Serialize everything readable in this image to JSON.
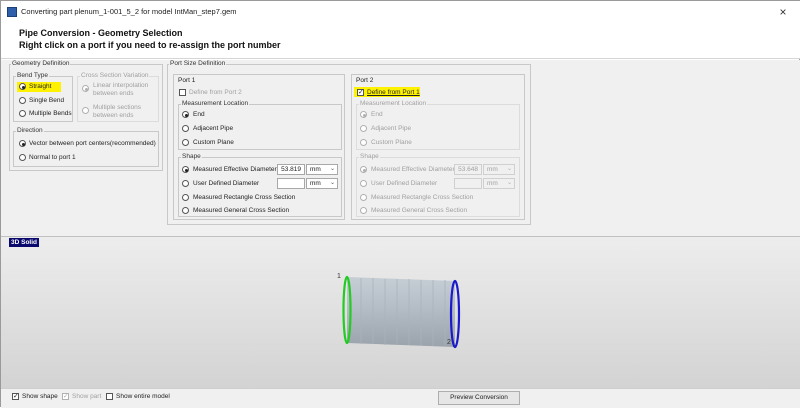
{
  "window": {
    "title": "Converting part plenum_1-001_5_2 for model IntMan_step7.gem",
    "close": "×"
  },
  "header": {
    "title": "Pipe Conversion - Geometry Selection",
    "subtitle": "Right click on a port if you need to re-assign the port number"
  },
  "geometry_definition": {
    "group_label": "Geometry Definition",
    "bend_type": {
      "label": "Bend Type",
      "options": [
        {
          "label": "Straight",
          "selected": true
        },
        {
          "label": "Single Bend",
          "selected": false
        },
        {
          "label": "Multiple Bends",
          "selected": false
        }
      ]
    },
    "cross_section": {
      "label": "Cross Section Variation",
      "options": [
        {
          "line1": "Linear interpolation",
          "line2": "between ends",
          "selected": true
        },
        {
          "line1": "Multiple sections",
          "line2": "between ends",
          "selected": false
        }
      ]
    },
    "direction": {
      "label": "Direction",
      "options": [
        {
          "label": "Vector between port centers(recommended)",
          "selected": true
        },
        {
          "label": "Normal to port 1",
          "selected": false
        }
      ]
    }
  },
  "port_size_definition": {
    "group_label": "Port Size Definition",
    "port1": {
      "label": "Port 1",
      "define_from": {
        "label": "Define from Port 2",
        "checked": false
      },
      "measurement": {
        "label": "Measurement Location",
        "options": [
          "End",
          "Adjacent Pipe",
          "Custom Plane"
        ],
        "selected": "End"
      },
      "shape": {
        "label": "Shape",
        "options": [
          "Measured Effective Diameter",
          "User Defined Diameter",
          "Measured Rectangle Cross Section",
          "Measured General Cross Section"
        ],
        "selected": "Measured Effective Diameter",
        "effective_diameter": "53.819",
        "effective_unit": "mm",
        "user_diameter": "",
        "user_unit": "mm"
      }
    },
    "port2": {
      "label": "Port 2",
      "define_from": {
        "label": "Define from Port 1",
        "checked": true
      },
      "measurement": {
        "label": "Measurement Location",
        "options": [
          "End",
          "Adjacent Pipe",
          "Custom Plane"
        ],
        "selected": "End"
      },
      "shape": {
        "label": "Shape",
        "options": [
          "Measured Effective Diameter",
          "User Defined Diameter",
          "Measured Rectangle Cross Section",
          "Measured General Cross Section"
        ],
        "selected": "Measured Effective Diameter",
        "effective_diameter": "53.648",
        "effective_unit": "mm",
        "user_diameter": "",
        "user_unit": "mm"
      }
    }
  },
  "viewport": {
    "tag": "3D Solid",
    "port1_marker": "1",
    "port2_marker": "2"
  },
  "footer": {
    "show_shape": {
      "label": "Show shape",
      "checked": true
    },
    "show_part": {
      "label": "Show part",
      "checked": true
    },
    "show_entire_model": {
      "label": "Show entire model",
      "checked": false
    },
    "preview_button": "Preview Conversion"
  },
  "colors": {
    "highlight": "#fff200",
    "port1_ring": "#22cc22",
    "port2_ring": "#1a1acc",
    "view_tag_bg": "#0a0a6e"
  }
}
